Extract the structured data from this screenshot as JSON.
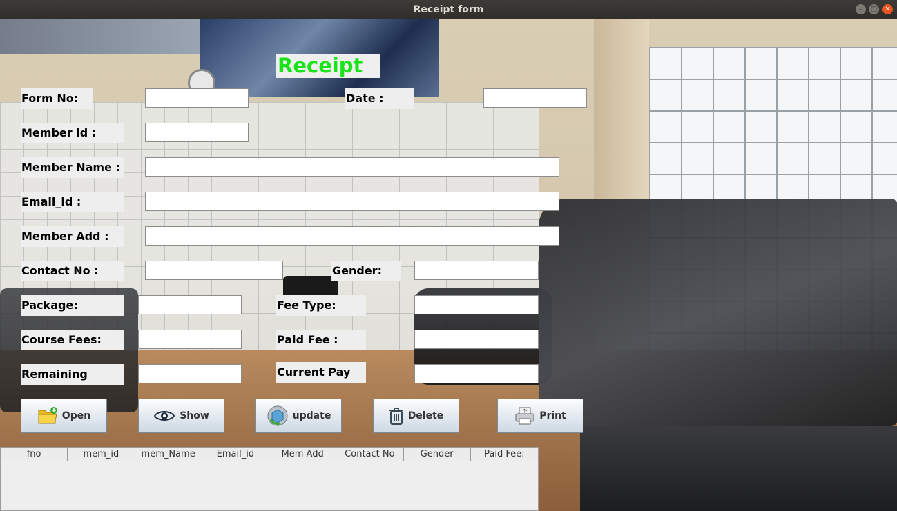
{
  "window": {
    "title": "Receipt form"
  },
  "heading": "Receipt",
  "labels": {
    "form_no": "Form No:",
    "date": "Date :",
    "member_id": "Member id :",
    "member_name": "Member Name :",
    "email_id": "Email_id :",
    "member_add": "Member Add :",
    "contact_no": "Contact No :",
    "gender": "Gender:",
    "package": "Package:",
    "fee_type": "Fee Type:",
    "course_fees": "Course Fees:",
    "paid_fee": "Paid Fee :",
    "remaining": "Remaining",
    "current_pay": "Current Pay"
  },
  "fields": {
    "form_no": "",
    "date": "",
    "member_id": "",
    "member_name": "",
    "email_id": "",
    "member_add": "",
    "contact_no": "",
    "gender": "",
    "package": "",
    "fee_type": "",
    "course_fees": "",
    "paid_fee": "",
    "remaining": "",
    "current_pay": ""
  },
  "buttons": {
    "open": "Open",
    "show": "Show",
    "update": "update",
    "delete": "Delete",
    "print": "Print"
  },
  "table": {
    "columns": [
      "fno",
      "mem_id",
      "mem_Name",
      "Email_id",
      "Mem Add",
      "Contact No",
      "Gender",
      "Paid Fee:"
    ],
    "rows": []
  },
  "colors": {
    "heading": "#18e418",
    "close_button": "#e95420"
  }
}
